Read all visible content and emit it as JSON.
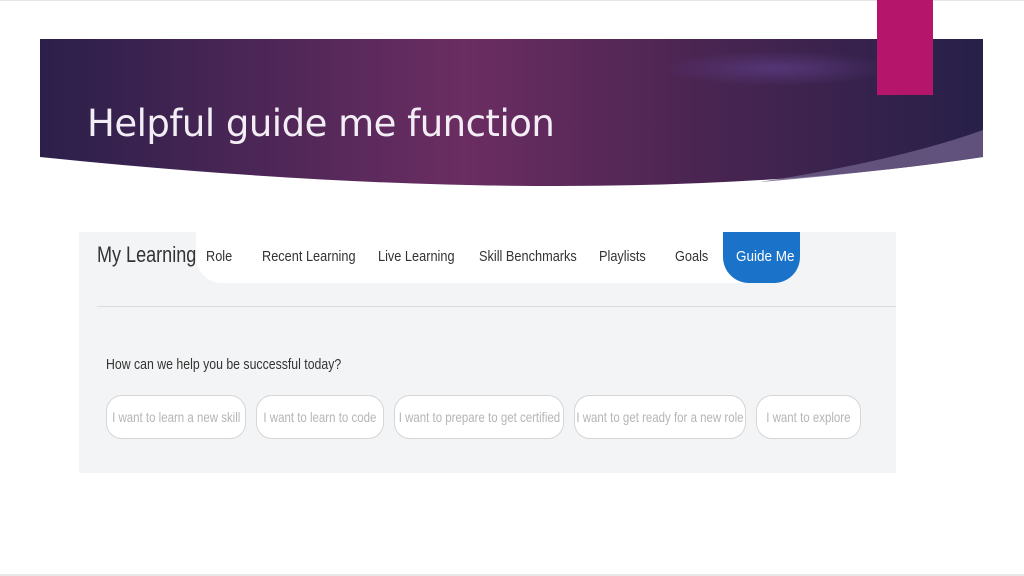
{
  "slide": {
    "title": "Helpful guide me function",
    "colors": {
      "banner_dark": "#2b1f4a",
      "banner_mid": "#6b2d62",
      "accent": "#b5156a"
    }
  },
  "app": {
    "brand": "My Learning",
    "nav": [
      {
        "label": "Role",
        "active": false
      },
      {
        "label": "Recent Learning",
        "active": false
      },
      {
        "label": "Live Learning",
        "active": false
      },
      {
        "label": "Skill Benchmarks",
        "active": false
      },
      {
        "label": "Playlists",
        "active": false
      },
      {
        "label": "Goals",
        "active": false
      },
      {
        "label": "Guide Me",
        "active": true
      }
    ],
    "active_color": "#1a73c8",
    "question": "How can we help you be successful today?",
    "options": [
      "I want to learn a new skill",
      "I want to learn to code",
      "I want to prepare to get certified",
      "I want to get ready for a new role",
      "I want to explore"
    ]
  }
}
